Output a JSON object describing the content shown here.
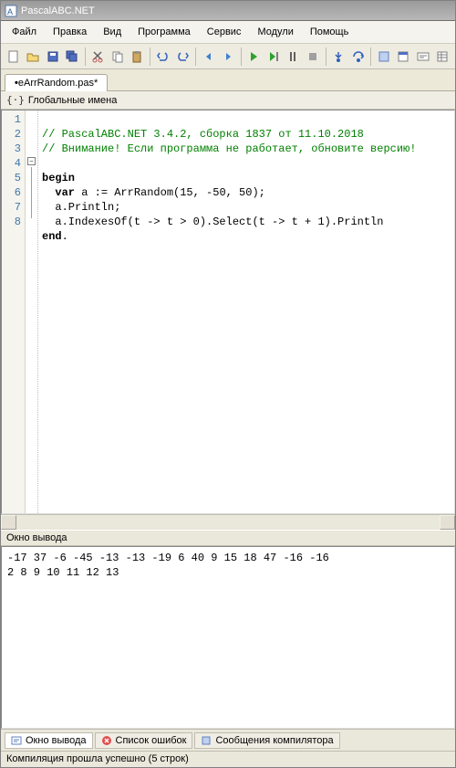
{
  "title": "PascalABC.NET",
  "menu": [
    "Файл",
    "Правка",
    "Вид",
    "Программа",
    "Сервис",
    "Модули",
    "Помощь"
  ],
  "toolbar_icons": [
    "new-file-icon",
    "open-icon",
    "save-icon",
    "save-all-icon",
    "sep",
    "cut-icon",
    "copy-icon",
    "paste-icon",
    "sep",
    "undo-icon",
    "redo-icon",
    "sep",
    "nav-back-icon",
    "nav-fwd-icon",
    "sep",
    "run-icon",
    "run-no-debug-icon",
    "debug-icon",
    "stop-icon",
    "sep",
    "step-into-icon",
    "step-over-icon",
    "sep",
    "module-icon",
    "form-icon",
    "output-window-icon",
    "props-icon"
  ],
  "tab": "eArrRandom.pas*",
  "globals_label": "Глобальные имена",
  "line_numbers": [
    "1",
    "2",
    "3",
    "4",
    "5",
    "6",
    "7",
    "8"
  ],
  "code": {
    "l1": "// PascalABC.NET 3.4.2, сборка 1837 от 11.10.2018",
    "l2": "// Внимание! Если программа не работает, обновите версию!",
    "l3": "",
    "l4_kw": "begin",
    "l5a": "  ",
    "l5_kw": "var",
    "l5b": " a := ArrRandom(15, -50, 50);",
    "l6": "  a.Println;",
    "l7": "  a.IndexesOf(t -> t > 0).Select(t -> t + 1).Println",
    "l8_kw": "end",
    "l8b": "."
  },
  "output_title": "Окно вывода",
  "output_lines": [
    "-17 37 -6 -45 -13 -13 -19 6 40 9 15 18 47 -16 -16",
    "2 8 9 10 11 12 13"
  ],
  "bottom_tabs": {
    "output": "Окно вывода",
    "errors": "Список ошибок",
    "compiler": "Сообщения компилятора"
  },
  "status": "Компиляция прошла успешно (5 строк)"
}
